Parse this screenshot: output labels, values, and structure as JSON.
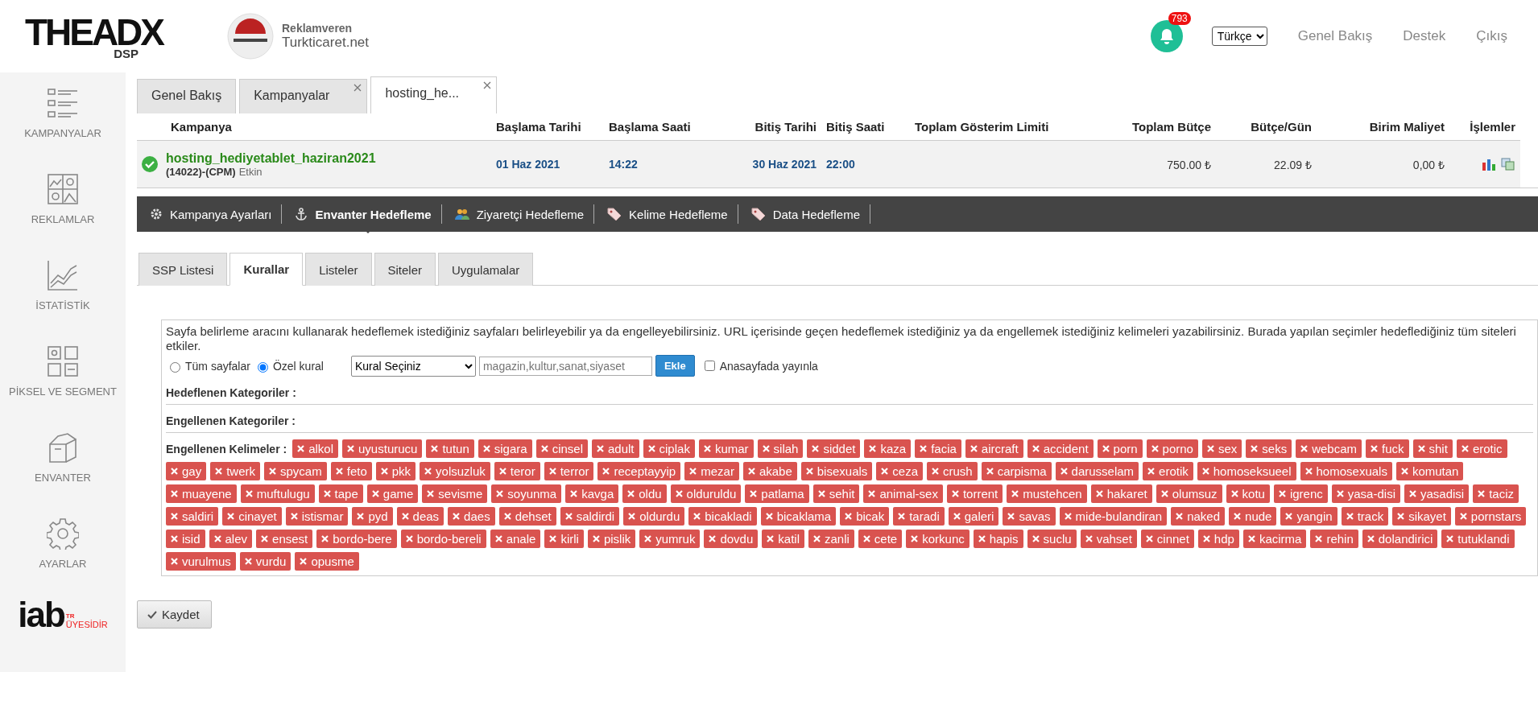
{
  "header": {
    "logo": {
      "text": "THEADX",
      "sub": "DSP"
    },
    "advertiser": {
      "label": "Reklamveren",
      "name": "Turkticaret.net"
    },
    "notifications": {
      "count": "793"
    },
    "language": {
      "value": "Türkçe"
    },
    "links": [
      "Genel Bakış",
      "Destek",
      "Çıkış"
    ]
  },
  "sidebar": {
    "items": [
      {
        "label": "KAMPANYALAR",
        "kind": "list"
      },
      {
        "label": "REKLAMLAR",
        "kind": "images"
      },
      {
        "label": "İSTATİSTİK",
        "kind": "chart"
      },
      {
        "label": "PİKSEL VE SEGMENT",
        "kind": "grid"
      },
      {
        "label": "ENVANTER",
        "kind": "box"
      },
      {
        "label": "AYARLAR",
        "kind": "gear"
      }
    ],
    "member_badge": {
      "text": "iab",
      "country": "TR",
      "note": "ÜYESİDİR"
    }
  },
  "page_tabs": [
    {
      "label": "Genel Bakış",
      "selected": false,
      "closable": false
    },
    {
      "label": "Kampanyalar",
      "selected": false,
      "closable": true
    },
    {
      "label": "hosting_he...",
      "selected": true,
      "closable": true
    }
  ],
  "campaign_table": {
    "columns": [
      "Kampanya",
      "Başlama Tarihi",
      "Başlama Saati",
      "Bitiş Tarihi",
      "Bitiş Saati",
      "Toplam Gösterim Limiti",
      "Toplam Bütçe",
      "Bütçe/Gün",
      "Birim Maliyet",
      "İşlemler"
    ],
    "rows": [
      {
        "active": true,
        "name": "hosting_hediyetablet_haziran2021",
        "meta": "(14022)-(CPM)",
        "status": "Etkin",
        "start_date": "01 Haz 2021",
        "start_time": "14:22",
        "end_date": "30 Haz 2021",
        "end_time": "22:00",
        "total_budget": "750.00 ₺",
        "daily_budget": "22.09 ₺",
        "unit_cost": "0,00 ₺"
      }
    ]
  },
  "settings_nav": [
    {
      "label": "Kampanya Ayarları",
      "kind": "gear",
      "selected": false
    },
    {
      "label": "Envanter Hedefleme",
      "kind": "anchor",
      "selected": true
    },
    {
      "label": "Ziyaretçi Hedefleme",
      "kind": "people",
      "selected": false
    },
    {
      "label": "Kelime Hedefleme",
      "kind": "tag",
      "selected": false
    },
    {
      "label": "Data Hedefleme",
      "kind": "tag",
      "selected": false
    }
  ],
  "sub_tabs": [
    {
      "label": "SSP Listesi",
      "selected": false
    },
    {
      "label": "Kurallar",
      "selected": true
    },
    {
      "label": "Listeler",
      "selected": false
    },
    {
      "label": "Siteler",
      "selected": false
    },
    {
      "label": "Uygulamalar",
      "selected": false
    }
  ],
  "rules": {
    "description": "Sayfa belirleme aracını kullanarak hedeflemek istediğiniz sayfaları belirleyebilir ya da engelleyebilirsiniz. URL içerisinde geçen hedeflemek istediğiniz ya da engellemek istediğiniz kelimeleri yazabilirsiniz. Burada yapılan seçimler hedeflediğiniz tüm siteleri etkiler.",
    "scope_options": [
      {
        "label": "Tüm sayfalar",
        "selected": false
      },
      {
        "label": "Özel kural",
        "selected": true
      }
    ],
    "rule_select": {
      "value": "Kural Seçiniz"
    },
    "keyword_input": {
      "placeholder": "magazin,kultur,sanat,siyaset"
    },
    "add_button": "Ekle",
    "homepage": {
      "label": "Anasayfada yayınla",
      "checked": false
    },
    "targeted_categories": "Hedeflenen Kategoriler :",
    "blocked_categories": "Engellenen Kategoriler :",
    "blocked_keywords": {
      "label": "Engellenen Kelimeler :",
      "items": [
        "alkol",
        "uyusturucu",
        "tutun",
        "sigara",
        "cinsel",
        "adult",
        "ciplak",
        "kumar",
        "silah",
        "siddet",
        "kaza",
        "facia",
        "aircraft",
        "accident",
        "porn",
        "porno",
        "sex",
        "seks",
        "webcam",
        "fuck",
        "shit",
        "erotic",
        "gay",
        "twerk",
        "spycam",
        "feto",
        "pkk",
        "yolsuzluk",
        "teror",
        "terror",
        "receptayyip",
        "mezar",
        "akabe",
        "bisexuals",
        "ceza",
        "crush",
        "carpisma",
        "darusselam",
        "erotik",
        "homoseksueel",
        "homosexuals",
        "komutan",
        "muayene",
        "muftulugu",
        "tape",
        "game",
        "sevisme",
        "soyunma",
        "kavga",
        "oldu",
        "olduruldu",
        "patlama",
        "sehit",
        "animal-sex",
        "torrent",
        "mustehcen",
        "hakaret",
        "olumsuz",
        "kotu",
        "igrenc",
        "yasa-disi",
        "yasadisi",
        "taciz",
        "saldiri",
        "cinayet",
        "istismar",
        "pyd",
        "deas",
        "daes",
        "dehset",
        "saldirdi",
        "oldurdu",
        "bicakladi",
        "bicaklama",
        "bicak",
        "taradi",
        "galeri",
        "savas",
        "mide-bulandiran",
        "naked",
        "nude",
        "yangin",
        "track",
        "sikayet",
        "pornstars",
        "isid",
        "alev",
        "ensest",
        "bordo-bere",
        "bordo-bereli",
        "anale",
        "kirli",
        "pislik",
        "yumruk",
        "dovdu",
        "katil",
        "zanli",
        "cete",
        "korkunc",
        "hapis",
        "suclu",
        "vahset",
        "cinnet",
        "hdp",
        "kacirma",
        "rehin",
        "dolandirici",
        "tutuklandi",
        "vurulmus",
        "vurdu",
        "opusme"
      ]
    }
  },
  "save_button": "Kaydet"
}
